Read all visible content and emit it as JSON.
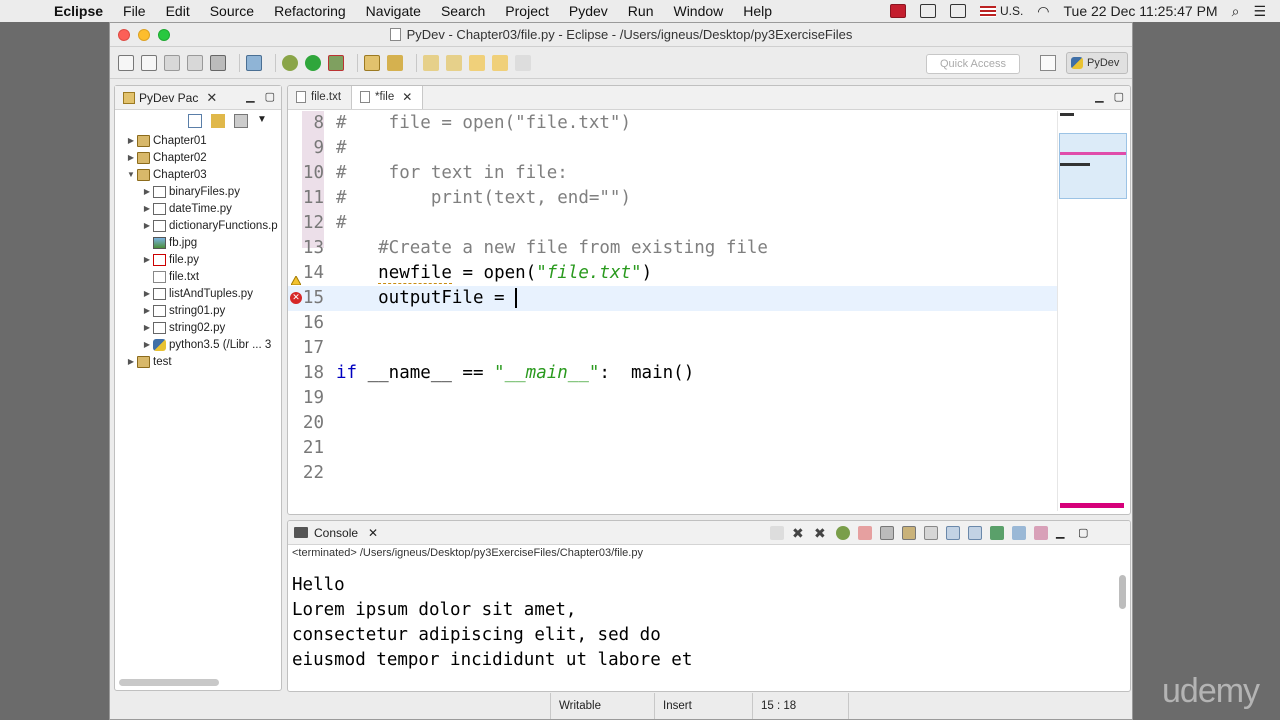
{
  "menubar": {
    "app": "Eclipse",
    "items": [
      "File",
      "Edit",
      "Source",
      "Refactoring",
      "Navigate",
      "Search",
      "Project",
      "Pydev",
      "Run",
      "Window",
      "Help"
    ],
    "input_source": "U.S.",
    "clock": "Tue 22 Dec  11:25:47 PM"
  },
  "window": {
    "title": "PyDev - Chapter03/file.py - Eclipse - /Users/igneus/Desktop/py3ExerciseFiles"
  },
  "toolbar": {
    "quick_access_placeholder": "Quick Access",
    "perspective": "PyDev"
  },
  "package_explorer": {
    "tab_label": "PyDev Pac",
    "items": [
      {
        "label": "Chapter01",
        "type": "project",
        "arrow": "▶",
        "indent": 0
      },
      {
        "label": "Chapter02",
        "type": "project",
        "arrow": "▶",
        "indent": 0
      },
      {
        "label": "Chapter03",
        "type": "project",
        "arrow": "▼",
        "indent": 0
      },
      {
        "label": "binaryFiles.py",
        "type": "pyfile",
        "arrow": "▶",
        "indent": 1
      },
      {
        "label": "dateTime.py",
        "type": "pyfile",
        "arrow": "▶",
        "indent": 1
      },
      {
        "label": "dictionaryFunctions.p",
        "type": "pyfile",
        "arrow": "▶",
        "indent": 1
      },
      {
        "label": "fb.jpg",
        "type": "image",
        "arrow": "",
        "indent": 1
      },
      {
        "label": "file.py",
        "type": "pyfile-err",
        "arrow": "▶",
        "indent": 1
      },
      {
        "label": "file.txt",
        "type": "txt",
        "arrow": "",
        "indent": 1
      },
      {
        "label": "listAndTuples.py",
        "type": "pyfile",
        "arrow": "▶",
        "indent": 1
      },
      {
        "label": "string01.py",
        "type": "pyfile",
        "arrow": "▶",
        "indent": 1
      },
      {
        "label": "string02.py",
        "type": "pyfile",
        "arrow": "▶",
        "indent": 1
      },
      {
        "label": "python3.5  (/Libr ... 3",
        "type": "python",
        "arrow": "▶",
        "indent": 1
      },
      {
        "label": "test",
        "type": "project",
        "arrow": "▶",
        "indent": 0
      }
    ]
  },
  "editor": {
    "tabs": [
      {
        "label": "file.txt",
        "active": false
      },
      {
        "label": "*file",
        "active": true
      }
    ],
    "lines": [
      {
        "num": "8",
        "text": "#    file = open(\"file.txt\")"
      },
      {
        "num": "9",
        "text": "#"
      },
      {
        "num": "10",
        "text": "#    for text in file:"
      },
      {
        "num": "11",
        "text": "#        print(text, end=\"\")"
      },
      {
        "num": "12",
        "text": "#"
      },
      {
        "num": "13",
        "text": "    #Create a new file from existing file"
      },
      {
        "num": "14",
        "text": "    newfile = open(\"file.txt\")"
      },
      {
        "num": "15",
        "text": "    outputFile = "
      },
      {
        "num": "16",
        "text": ""
      },
      {
        "num": "17",
        "text": ""
      },
      {
        "num": "18",
        "text": "if __name__ == \"__main__\":  main()"
      },
      {
        "num": "19",
        "text": ""
      },
      {
        "num": "20",
        "text": ""
      },
      {
        "num": "21",
        "text": ""
      },
      {
        "num": "22",
        "text": ""
      }
    ]
  },
  "console": {
    "tab_label": "Console",
    "status": "<terminated> /Users/igneus/Desktop/py3ExerciseFiles/Chapter03/file.py",
    "output": "Hello\nLorem ipsum dolor sit amet,\nconsectetur adipiscing elit, sed do\neiusmod tempor incididunt ut labore et"
  },
  "statusbar": {
    "writable": "Writable",
    "insert_mode": "Insert",
    "position": "15 : 18"
  },
  "watermark": "udemy",
  "colors": {
    "comment": "#7f7f7f",
    "string": "#2a9a1e",
    "keyword": "#0000c0",
    "current_line": "#e8f2fe",
    "error": "#d62828"
  }
}
